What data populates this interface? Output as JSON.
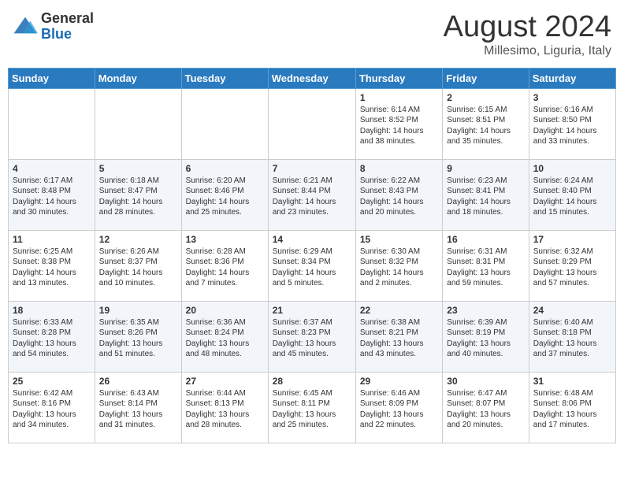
{
  "header": {
    "logo_general": "General",
    "logo_blue": "Blue",
    "month_year": "August 2024",
    "location": "Millesimo, Liguria, Italy"
  },
  "weekdays": [
    "Sunday",
    "Monday",
    "Tuesday",
    "Wednesday",
    "Thursday",
    "Friday",
    "Saturday"
  ],
  "weeks": [
    [
      {
        "day": "",
        "info": ""
      },
      {
        "day": "",
        "info": ""
      },
      {
        "day": "",
        "info": ""
      },
      {
        "day": "",
        "info": ""
      },
      {
        "day": "1",
        "info": "Sunrise: 6:14 AM\nSunset: 8:52 PM\nDaylight: 14 hours\nand 38 minutes."
      },
      {
        "day": "2",
        "info": "Sunrise: 6:15 AM\nSunset: 8:51 PM\nDaylight: 14 hours\nand 35 minutes."
      },
      {
        "day": "3",
        "info": "Sunrise: 6:16 AM\nSunset: 8:50 PM\nDaylight: 14 hours\nand 33 minutes."
      }
    ],
    [
      {
        "day": "4",
        "info": "Sunrise: 6:17 AM\nSunset: 8:48 PM\nDaylight: 14 hours\nand 30 minutes."
      },
      {
        "day": "5",
        "info": "Sunrise: 6:18 AM\nSunset: 8:47 PM\nDaylight: 14 hours\nand 28 minutes."
      },
      {
        "day": "6",
        "info": "Sunrise: 6:20 AM\nSunset: 8:46 PM\nDaylight: 14 hours\nand 25 minutes."
      },
      {
        "day": "7",
        "info": "Sunrise: 6:21 AM\nSunset: 8:44 PM\nDaylight: 14 hours\nand 23 minutes."
      },
      {
        "day": "8",
        "info": "Sunrise: 6:22 AM\nSunset: 8:43 PM\nDaylight: 14 hours\nand 20 minutes."
      },
      {
        "day": "9",
        "info": "Sunrise: 6:23 AM\nSunset: 8:41 PM\nDaylight: 14 hours\nand 18 minutes."
      },
      {
        "day": "10",
        "info": "Sunrise: 6:24 AM\nSunset: 8:40 PM\nDaylight: 14 hours\nand 15 minutes."
      }
    ],
    [
      {
        "day": "11",
        "info": "Sunrise: 6:25 AM\nSunset: 8:38 PM\nDaylight: 14 hours\nand 13 minutes."
      },
      {
        "day": "12",
        "info": "Sunrise: 6:26 AM\nSunset: 8:37 PM\nDaylight: 14 hours\nand 10 minutes."
      },
      {
        "day": "13",
        "info": "Sunrise: 6:28 AM\nSunset: 8:36 PM\nDaylight: 14 hours\nand 7 minutes."
      },
      {
        "day": "14",
        "info": "Sunrise: 6:29 AM\nSunset: 8:34 PM\nDaylight: 14 hours\nand 5 minutes."
      },
      {
        "day": "15",
        "info": "Sunrise: 6:30 AM\nSunset: 8:32 PM\nDaylight: 14 hours\nand 2 minutes."
      },
      {
        "day": "16",
        "info": "Sunrise: 6:31 AM\nSunset: 8:31 PM\nDaylight: 13 hours\nand 59 minutes."
      },
      {
        "day": "17",
        "info": "Sunrise: 6:32 AM\nSunset: 8:29 PM\nDaylight: 13 hours\nand 57 minutes."
      }
    ],
    [
      {
        "day": "18",
        "info": "Sunrise: 6:33 AM\nSunset: 8:28 PM\nDaylight: 13 hours\nand 54 minutes."
      },
      {
        "day": "19",
        "info": "Sunrise: 6:35 AM\nSunset: 8:26 PM\nDaylight: 13 hours\nand 51 minutes."
      },
      {
        "day": "20",
        "info": "Sunrise: 6:36 AM\nSunset: 8:24 PM\nDaylight: 13 hours\nand 48 minutes."
      },
      {
        "day": "21",
        "info": "Sunrise: 6:37 AM\nSunset: 8:23 PM\nDaylight: 13 hours\nand 45 minutes."
      },
      {
        "day": "22",
        "info": "Sunrise: 6:38 AM\nSunset: 8:21 PM\nDaylight: 13 hours\nand 43 minutes."
      },
      {
        "day": "23",
        "info": "Sunrise: 6:39 AM\nSunset: 8:19 PM\nDaylight: 13 hours\nand 40 minutes."
      },
      {
        "day": "24",
        "info": "Sunrise: 6:40 AM\nSunset: 8:18 PM\nDaylight: 13 hours\nand 37 minutes."
      }
    ],
    [
      {
        "day": "25",
        "info": "Sunrise: 6:42 AM\nSunset: 8:16 PM\nDaylight: 13 hours\nand 34 minutes."
      },
      {
        "day": "26",
        "info": "Sunrise: 6:43 AM\nSunset: 8:14 PM\nDaylight: 13 hours\nand 31 minutes."
      },
      {
        "day": "27",
        "info": "Sunrise: 6:44 AM\nSunset: 8:13 PM\nDaylight: 13 hours\nand 28 minutes."
      },
      {
        "day": "28",
        "info": "Sunrise: 6:45 AM\nSunset: 8:11 PM\nDaylight: 13 hours\nand 25 minutes."
      },
      {
        "day": "29",
        "info": "Sunrise: 6:46 AM\nSunset: 8:09 PM\nDaylight: 13 hours\nand 22 minutes."
      },
      {
        "day": "30",
        "info": "Sunrise: 6:47 AM\nSunset: 8:07 PM\nDaylight: 13 hours\nand 20 minutes."
      },
      {
        "day": "31",
        "info": "Sunrise: 6:48 AM\nSunset: 8:06 PM\nDaylight: 13 hours\nand 17 minutes."
      }
    ]
  ]
}
